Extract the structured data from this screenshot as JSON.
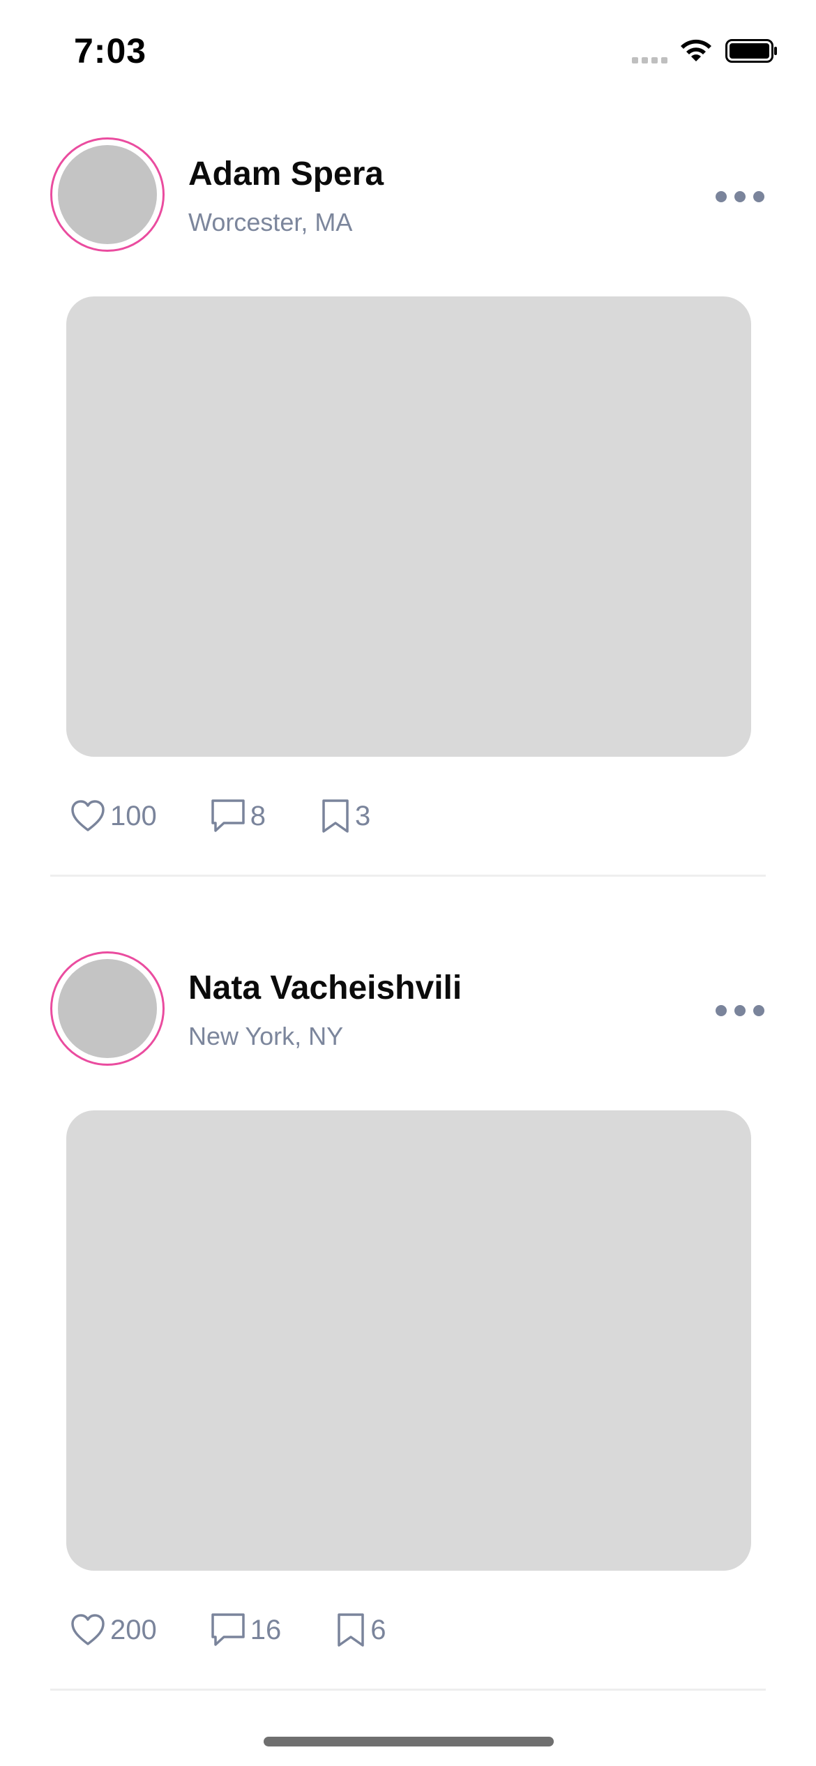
{
  "status_bar": {
    "time": "7:03",
    "icons": [
      "signal-icon",
      "wifi-icon",
      "battery-icon"
    ]
  },
  "colors": {
    "ring": "#ea4c9f",
    "secondary_text": "#7c869c",
    "icon": "#7a849b",
    "placeholder": "#d9d9d9"
  },
  "posts": [
    {
      "name": "Adam Spera",
      "location": "Worcester, MA",
      "likes": "100",
      "comments": "8",
      "bookmarks": "3"
    },
    {
      "name": "Nata Vacheishvili",
      "location": "New York, NY",
      "likes": "200",
      "comments": "16",
      "bookmarks": "6"
    }
  ]
}
